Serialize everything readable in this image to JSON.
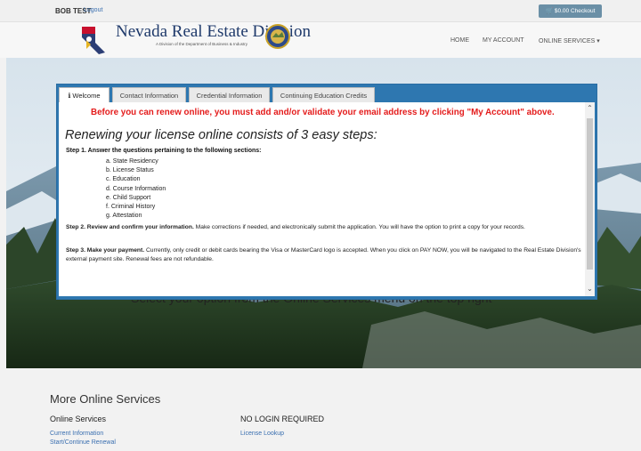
{
  "topbar": {
    "user": "BOB TEST",
    "logout": "Logout",
    "cart": "🛒 $0.00 Checkout"
  },
  "header": {
    "title": "Nevada Real Estate Division",
    "subtitle": "A Division of the Department of Business & Industry",
    "nav": [
      "HOME",
      "MY ACCOUNT",
      "ONLINE SERVICES ▾"
    ]
  },
  "tabs": [
    "ℹ Welcome",
    "Contact Information",
    "Credential Information",
    "Continuing Education Credits"
  ],
  "welcome": {
    "alert": "Before you can renew online, you must add and/or validate your email address by clicking \"My Account\" above.",
    "headline": "Renewing your license online consists of 3 easy steps:",
    "step1": "Step 1. Answer the questions pertaining to the following sections:",
    "sections": [
      "a. State Residency",
      "b. License Status",
      "c. Education",
      "d. Course Information",
      "e. Child Support",
      "f. Criminal History",
      "g. Attestation"
    ],
    "step2_title": "Step 2. Review and confirm your information.",
    "step2_body": " Make corrections if needed, and electronically submit the application. You will have the option to print a copy for your records.",
    "step3_title": "Step 3. Make your payment.",
    "step3_body": " Currently, only credit or debit cards bearing the Visa or MasterCard logo is accepted. When you click on PAY NOW, you will be navigated to the Real Estate Division's external payment site. Renewal fees are not refundable.",
    "select_msg": "Select your option from the Online Services menu on the top right"
  },
  "more": {
    "title": "More Online Services",
    "col1_head": "Online Services",
    "col1_links": [
      "Current Information",
      "Start/Continue Renewal"
    ],
    "col2_head": "NO LOGIN REQUIRED",
    "col2_links": [
      "License Lookup"
    ]
  },
  "colors": {
    "panel": "#2e77b0",
    "alert": "#e41b1b",
    "link": "#3a6fb0",
    "cart": "#6a8fa6"
  }
}
